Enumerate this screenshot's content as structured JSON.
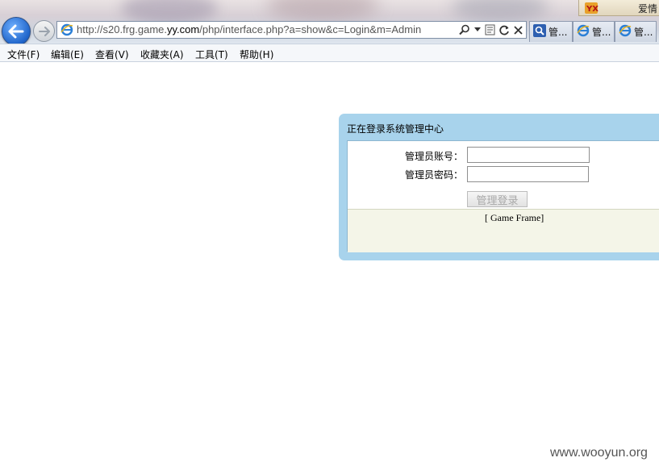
{
  "browser": {
    "address_url_prefix": "http://s20.frg.game.",
    "address_url_domain": "yy.com",
    "address_url_suffix": "/php/interface.php?a=show&c=Login&m=Admin",
    "tabs": [
      {
        "label": "管..."
      },
      {
        "label": "管..."
      },
      {
        "label": "管..."
      }
    ],
    "corner_tab_label": "爱情"
  },
  "menu": {
    "file": "文件(F)",
    "edit": "编辑(E)",
    "view": "查看(V)",
    "favorites": "收藏夹(A)",
    "tools": "工具(T)",
    "help": "帮助(H)"
  },
  "login": {
    "title": "正在登录系统管理中心",
    "account_label": "管理员账号：",
    "account_value": "",
    "password_label": "管理员密码：",
    "password_value": "",
    "submit_label": "管理登录",
    "footer_text": "[ Game Frame]"
  },
  "watermark": "www.wooyun.org",
  "colors": {
    "panel_bg": "#a8d3ec",
    "footer_bg": "#f4f5e8",
    "back_button": "#1f64c9"
  }
}
